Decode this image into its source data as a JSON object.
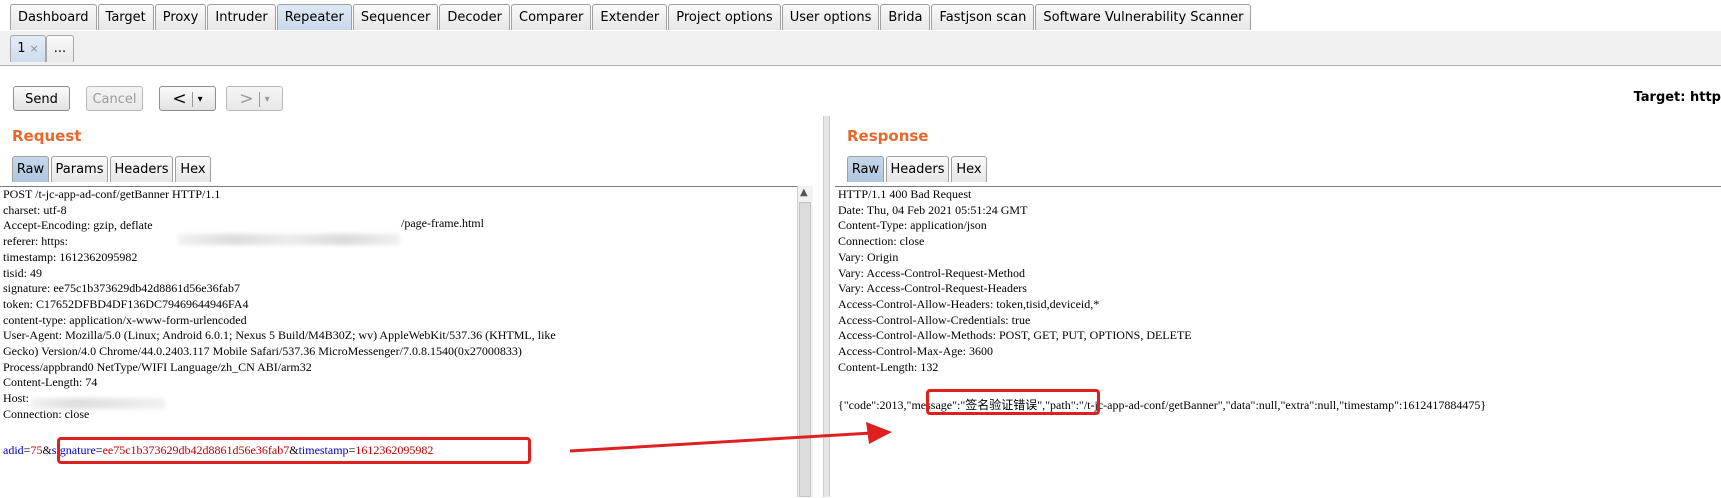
{
  "main_tabs": [
    "Dashboard",
    "Target",
    "Proxy",
    "Intruder",
    "Repeater",
    "Sequencer",
    "Decoder",
    "Comparer",
    "Extender",
    "Project options",
    "User options",
    "Brida",
    "Fastjson scan",
    "Software Vulnerability Scanner"
  ],
  "active_main_tab": "Repeater",
  "sub_tabs": {
    "first": "1",
    "close": "×",
    "more": "..."
  },
  "toolbar": {
    "send": "Send",
    "cancel": "Cancel",
    "prev": "<",
    "next": ">",
    "dropdown": "▾",
    "target_label": "Target: http"
  },
  "request": {
    "title": "Request",
    "tabs": [
      "Raw",
      "Params",
      "Headers",
      "Hex"
    ],
    "active_tab": "Raw",
    "lines": [
      "POST /t-jc-app-ad-conf/getBanner HTTP/1.1",
      "charset: utf-8",
      "Accept-Encoding: gzip, deflate",
      "referer: https:",
      "timestamp: 1612362095982",
      "tisid: 49",
      "signature: ee75c1b373629db42d8861d56e36fab7",
      "token: C17652DFBD4DF136DC79469644946FA4",
      "content-type: application/x-www-form-urlencoded",
      "User-Agent: Mozilla/5.0 (Linux; Android 6.0.1; Nexus 5 Build/M4B30Z; wv) AppleWebKit/537.36 (KHTML, like",
      "Gecko) Version/4.0 Chrome/44.0.2403.117 Mobile Safari/537.36 MicroMessenger/7.0.8.1540(0x27000833)",
      "Process/appbrand0 NetType/WIFI Language/zh_CN ABI/arm32",
      "Content-Length: 74",
      "Host:",
      "Connection: close"
    ],
    "referer_tail": "/page-frame.html",
    "body": {
      "k1": "adid",
      "eq": "=",
      "v1": "75",
      "amp": "&",
      "k2": "signature",
      "v2": "ee75c1b373629db42d8861d56e36fab7",
      "k3": "timestamp",
      "v3": "1612362095982"
    }
  },
  "response": {
    "title": "Response",
    "tabs": [
      "Raw",
      "Headers",
      "Hex"
    ],
    "active_tab": "Raw",
    "lines": [
      "HTTP/1.1 400 Bad Request",
      "Date: Thu, 04 Feb 2021 05:51:24 GMT",
      "Content-Type: application/json",
      "Connection: close",
      "Vary: Origin",
      "Vary: Access-Control-Request-Method",
      "Vary: Access-Control-Request-Headers",
      "Access-Control-Allow-Headers: token,tisid,deviceid,*",
      "Access-Control-Allow-Credentials: true",
      "Access-Control-Allow-Methods: POST, GET, PUT, OPTIONS, DELETE",
      "Access-Control-Max-Age: 3600",
      "Content-Length: 132"
    ],
    "body": {
      "part1": "{\"code\":2013,",
      "part2": "\"message\":\"签名验证错误\"",
      "part3": ",\"path\":\"/t-jc-app-ad-conf/getBanner\",\"data\":null,\"extra\":null,\"timestamp\":1612417884475}"
    }
  },
  "colors": {
    "accent": "#e8682c",
    "highlight": "#e02020",
    "param_key": "#0000c0",
    "param_value": "#c00000"
  }
}
